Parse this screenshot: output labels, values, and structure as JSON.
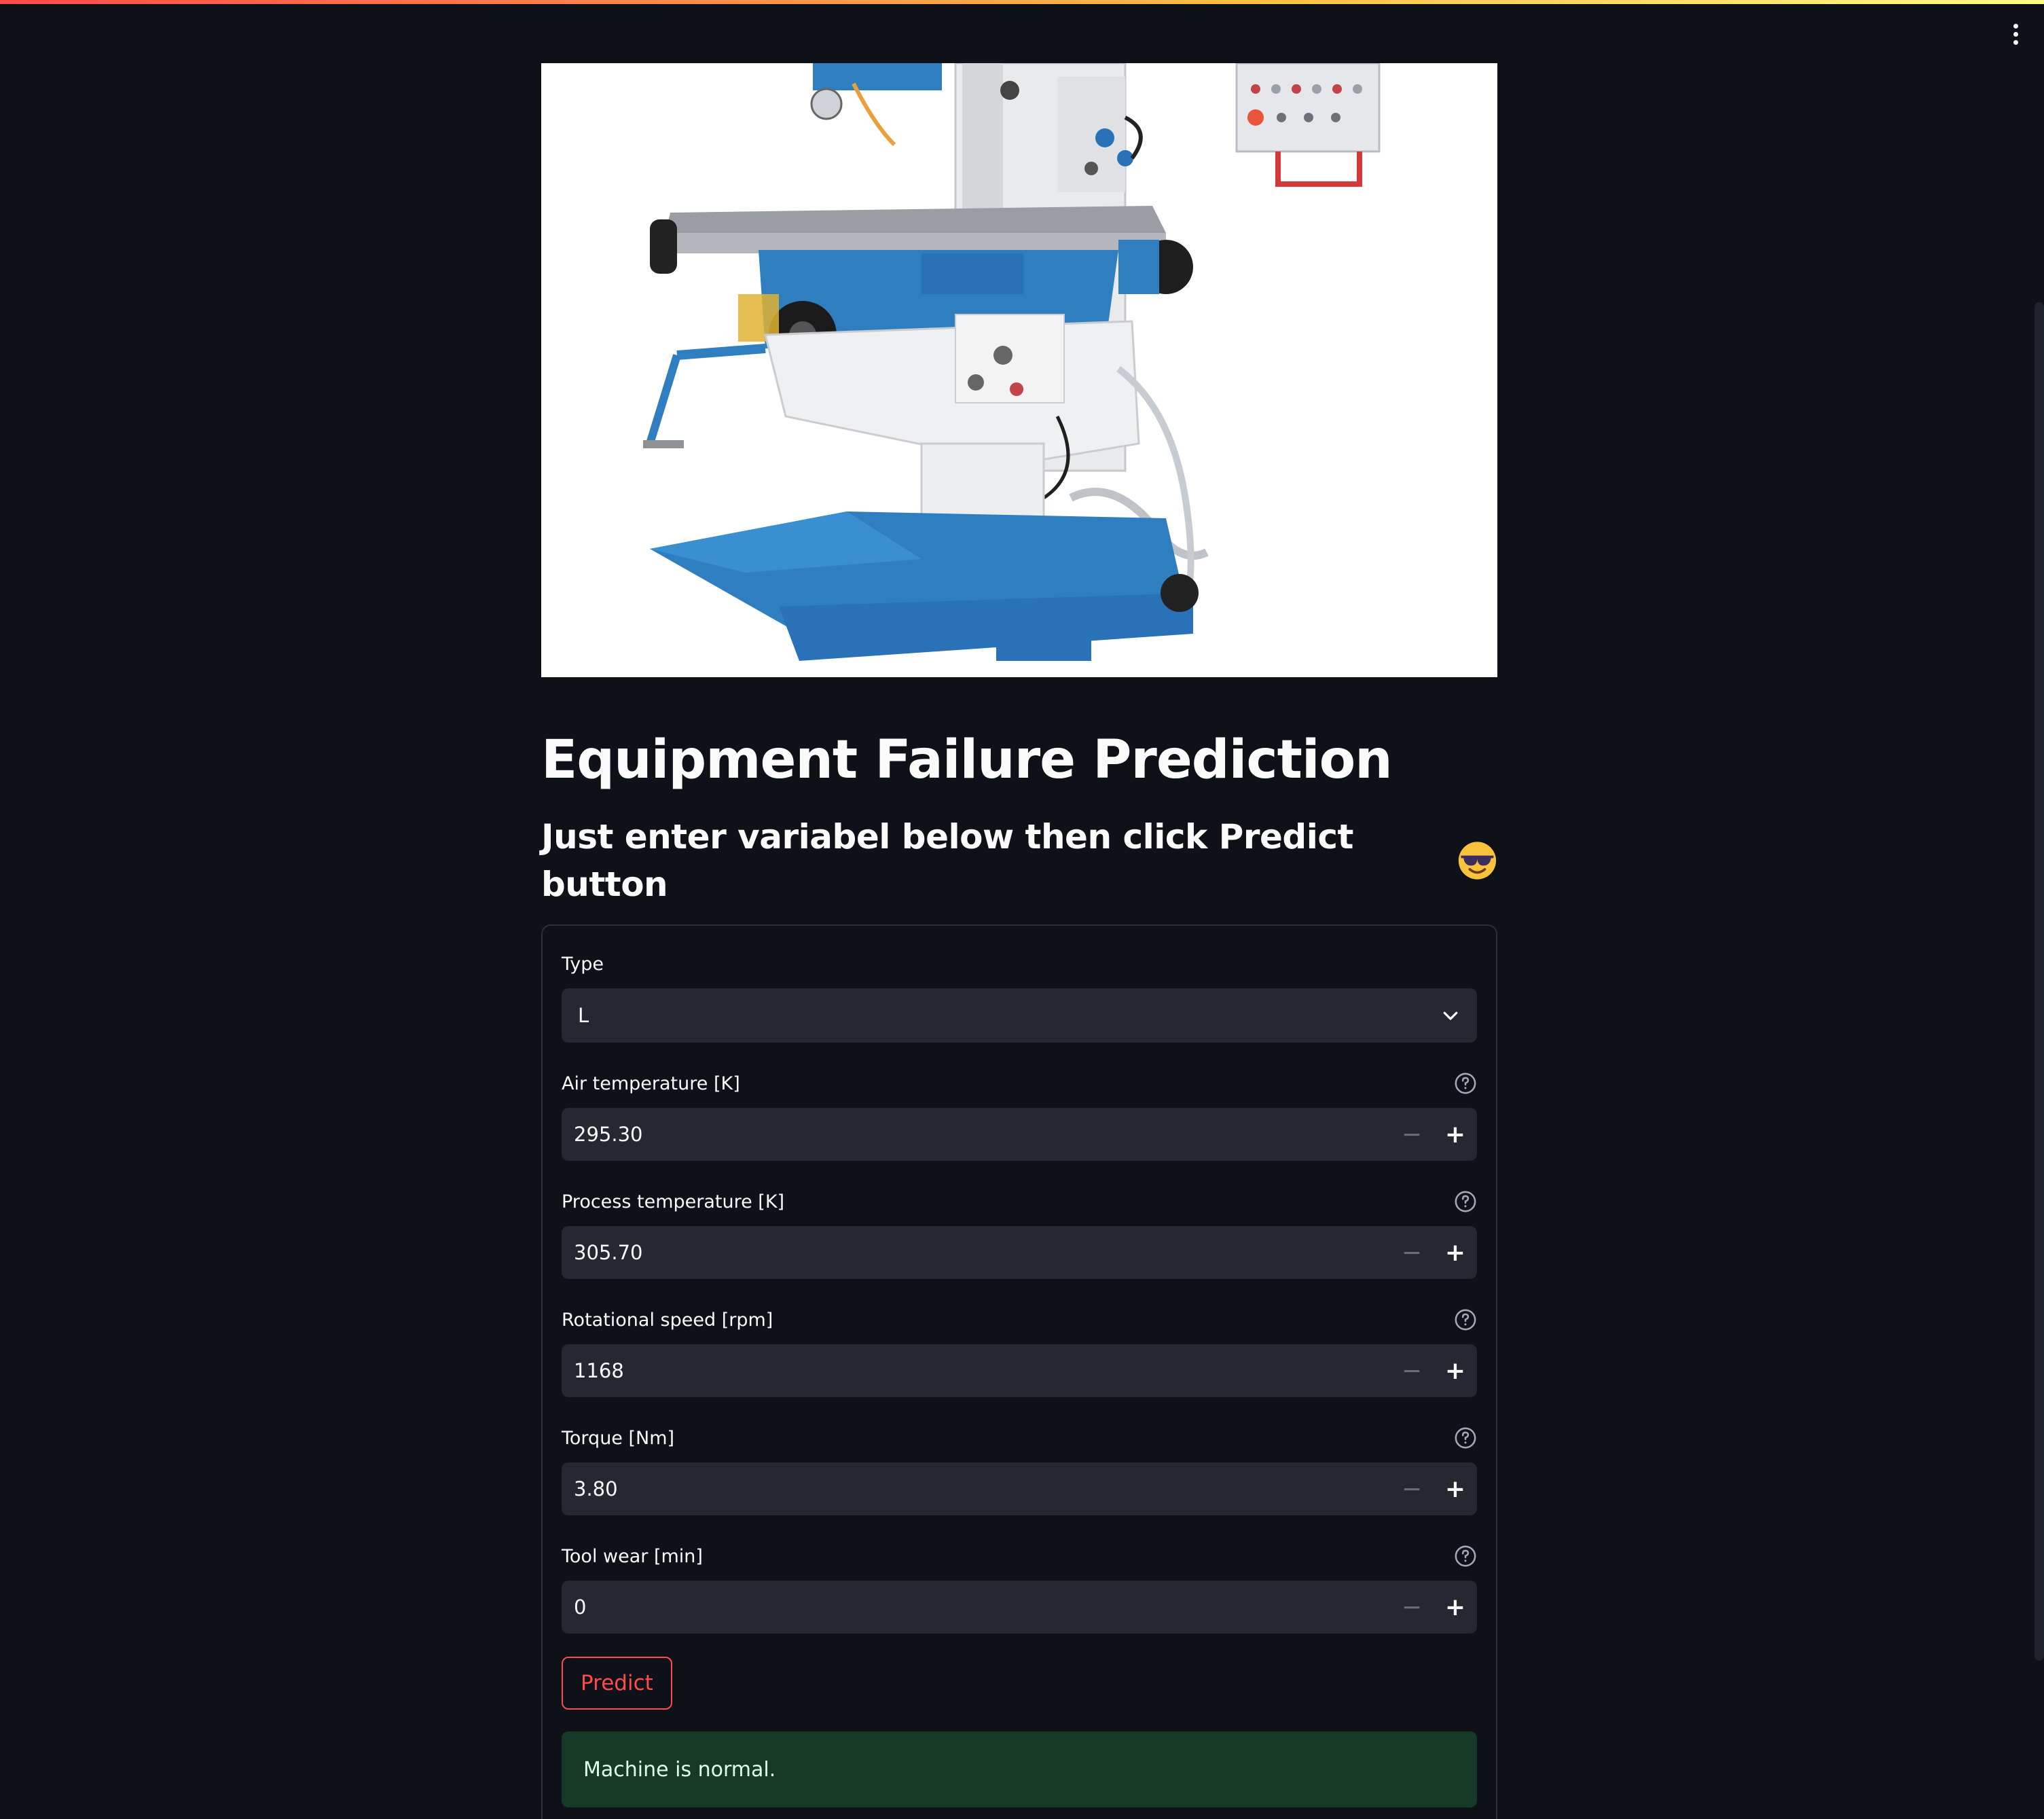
{
  "page": {
    "title": "Equipment Failure Prediction",
    "subtitle": "Just enter variabel below then click Predict button",
    "emoji": "smiling-face-with-sunglasses"
  },
  "hero_image": {
    "subject": "milling-machine"
  },
  "form": {
    "type_field": {
      "label": "Type",
      "value": "L"
    },
    "fields": [
      {
        "label": "Air temperature [K]",
        "value": "295.30"
      },
      {
        "label": "Process temperature [K]",
        "value": "305.70"
      },
      {
        "label": "Rotational speed [rpm]",
        "value": "1168"
      },
      {
        "label": "Torque [Nm]",
        "value": "3.80"
      },
      {
        "label": "Tool wear [min]",
        "value": "0"
      }
    ],
    "stepper_minus": "−",
    "stepper_plus": "+",
    "predict_label": "Predict"
  },
  "result": {
    "message": "Machine is normal."
  },
  "colors": {
    "background": "#0e1117",
    "input_bg": "#262730",
    "accent": "#ff4b4b",
    "success_bg": "#173928"
  }
}
